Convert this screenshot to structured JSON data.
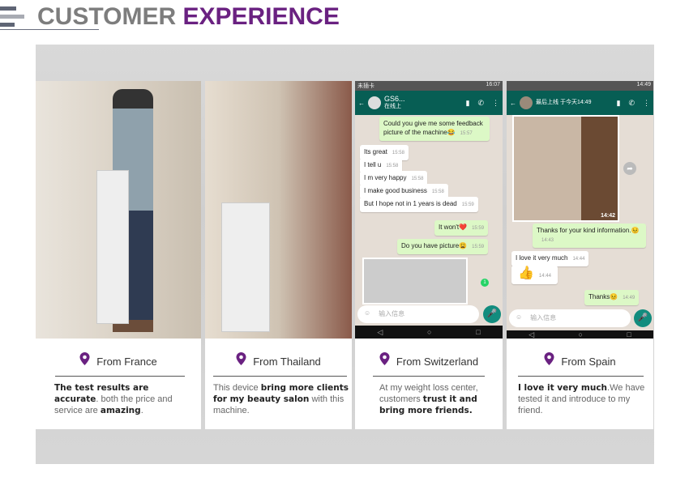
{
  "header": {
    "title_part1": "CUSTOMER",
    "title_part2": "EXPERIENCE"
  },
  "colors": {
    "accent": "#6a2181",
    "title_gray": "#7d7d7d"
  },
  "cards": [
    {
      "location": "From France",
      "icon": "location-pin-icon",
      "desc": [
        {
          "t": "The test results are accurate",
          "b": true
        },
        {
          "t": ". both the price and service are ",
          "b": false
        },
        {
          "t": "amazing",
          "b": true
        },
        {
          "t": ".",
          "b": false
        }
      ]
    },
    {
      "location": "From Thailand",
      "icon": "location-pin-icon",
      "desc": [
        {
          "t": "This device ",
          "b": false
        },
        {
          "t": "bring more clients for my beauty salon",
          "b": true
        },
        {
          "t": " with this machine.",
          "b": false
        }
      ]
    },
    {
      "location": "From Switzerland",
      "icon": "location-pin-icon",
      "desc": [
        {
          "t": "At my weight loss center, customers ",
          "b": false
        },
        {
          "t": "trust it and bring more friends.",
          "b": true
        }
      ]
    },
    {
      "location": "From Spain",
      "icon": "location-pin-icon",
      "desc": [
        {
          "t": "I love it very much",
          "b": true
        },
        {
          "t": ".We have tested it and introduce to my friend.",
          "b": false
        }
      ]
    }
  ],
  "chat1": {
    "status_left": "未插卡",
    "status_time": "16:07",
    "contact": "GS6...",
    "presence": "在线上",
    "messages": [
      {
        "text": "Could you give me some feedback picture of the machine😂",
        "time": "15:57",
        "out": true
      },
      {
        "text": "Its great",
        "time": "15:58",
        "out": false
      },
      {
        "text": "I tell u",
        "time": "15:58",
        "out": false
      },
      {
        "text": "I m very happy",
        "time": "15:58",
        "out": false
      },
      {
        "text": "I make good business",
        "time": "15:58",
        "out": false
      },
      {
        "text": "But I hope not in 1 years is dead",
        "time": "15:59",
        "out": false
      },
      {
        "text": "It won't❤️",
        "time": "15:59",
        "out": true
      },
      {
        "text": "Do you have picture😩",
        "time": "15:59",
        "out": true
      }
    ],
    "unread": "1",
    "input_placeholder": "输入信息"
  },
  "chat2": {
    "status_time": "14:49",
    "presence": "最后上线 于今天14:49",
    "image_time": "14:42",
    "messages": [
      {
        "text": "Thanks for your kind information.😣",
        "time": "14:43",
        "out": true
      },
      {
        "text": "I love it very much",
        "time": "14:44",
        "out": false
      },
      {
        "text": "👍",
        "time": "14:44",
        "out": false
      },
      {
        "text": "Thanks😣",
        "time": "14:49",
        "out": true
      }
    ],
    "input_placeholder": "输入信息"
  }
}
